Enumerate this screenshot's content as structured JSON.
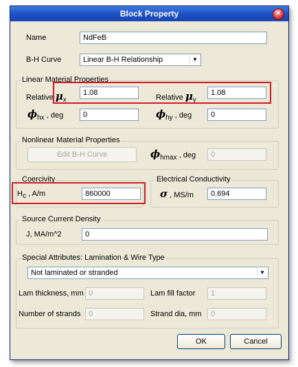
{
  "window": {
    "title": "Block Property"
  },
  "name": {
    "label": "Name",
    "value": "NdFeB"
  },
  "bh_curve": {
    "label": "B-H Curve",
    "value": "Linear B-H Relationship"
  },
  "linear": {
    "title": "Linear Material Properties",
    "relative_word": "Relative",
    "mu_symbol": "μ",
    "mu_x_sub": "x",
    "mu_x_value": "1.08",
    "mu_y_sub": "y",
    "mu_y_value": "1.08",
    "phi_symbol": "ϕ",
    "phi_hx_sub": "hx",
    "phi_hx_unit": ", deg",
    "phi_hx_value": "0",
    "phi_hy_sub": "hy",
    "phi_hy_unit": ", deg",
    "phi_hy_value": "0"
  },
  "nonlinear": {
    "title": "Nonlinear Material Properties",
    "edit_button": "Edit B-H Curve",
    "phi_hmax_sub": "hmax",
    "phi_hmax_unit": ", deg",
    "phi_hmax_value": "0"
  },
  "coercivity": {
    "title": "Coercivity",
    "symbol": "H",
    "sub": "c",
    "unit": ", A/m",
    "value": "860000"
  },
  "conductivity": {
    "title": "Electrical Conductivity",
    "symbol": "σ",
    "unit": ", MS/m",
    "value": "0.694"
  },
  "source": {
    "title": "Source Current Density",
    "label": "J, MA/m^2",
    "value": "0"
  },
  "special": {
    "title": "Special Attributes:  Lamination & Wire Type",
    "select_value": "Not laminated or stranded",
    "lam_thickness_label": "Lam thickness, mm",
    "lam_thickness_value": "0",
    "lam_fill_label": "Lam fill factor",
    "lam_fill_value": "1",
    "strands_label": "Number of strands",
    "strands_value": "0",
    "strand_dia_label": "Strand dia, mm",
    "strand_dia_value": "0"
  },
  "buttons": {
    "ok": "OK",
    "cancel": "Cancel"
  },
  "colors": {
    "highlight": "#d21b22",
    "titlebar": "#1c4fc4"
  }
}
